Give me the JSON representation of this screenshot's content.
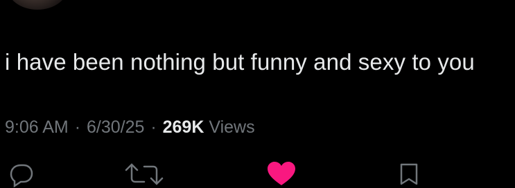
{
  "tweet": {
    "text": "i have been nothing but funny and sexy to you"
  },
  "meta": {
    "time": "9:06 AM",
    "separator": "·",
    "date": "6/30/25",
    "views_count": "269K",
    "views_label": "Views"
  },
  "actions": {
    "reply_icon": "reply-icon",
    "retweet_icon": "retweet-icon",
    "like_icon": "heart-icon",
    "bookmark_icon": "bookmark-icon",
    "like_active": true
  },
  "colors": {
    "background": "#000000",
    "text_primary": "#e7e9ea",
    "text_secondary": "#71767b",
    "like": "#f91880"
  }
}
